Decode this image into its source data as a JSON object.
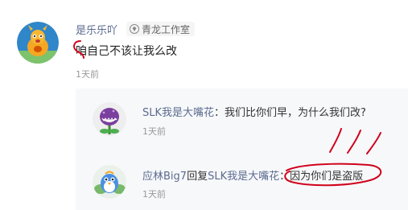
{
  "main_comment": {
    "username": "是乐乐吖",
    "badge_label": "青龙工作室",
    "text": "咱自己不该让我么改",
    "time": "1天前"
  },
  "replies": [
    {
      "name": "SLK我是大嘴花",
      "separator": "：",
      "text": "我们比你们早，为什么我们改?",
      "time": "1天前"
    },
    {
      "name": "应林Big7",
      "reply_word": "回复",
      "target": "SLK我是大嘴花",
      "separator": "：",
      "text": "因为你们是盗版",
      "time": "1天前"
    }
  ],
  "colors": {
    "username": "#5b6b8f",
    "text": "#222222",
    "time": "#999999",
    "reply_bg": "#f7f8fa",
    "annotation": "#d0021b"
  }
}
